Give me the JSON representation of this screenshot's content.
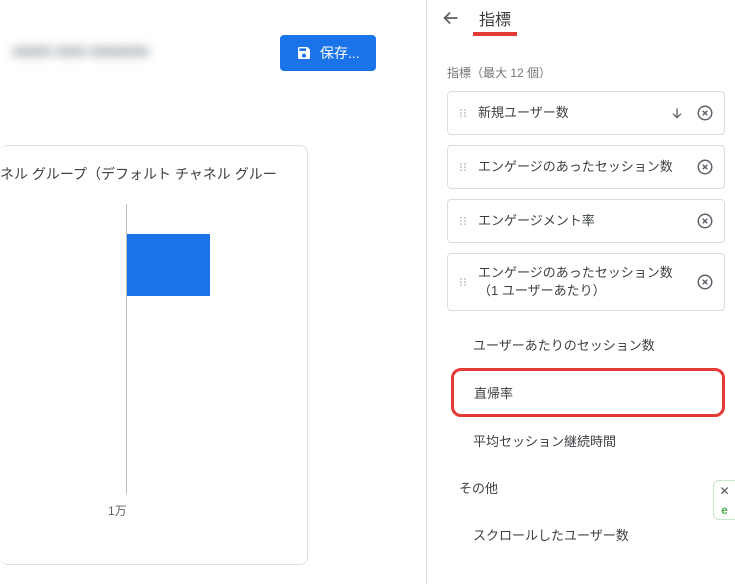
{
  "header": {
    "blurred_text": "■■■■ ■■■ ■■■■■■",
    "save_label": "保存..."
  },
  "card": {
    "title": "ネル グループ（デフォルト チャネル グルー"
  },
  "chart_data": {
    "type": "bar",
    "orientation": "horizontal",
    "x_tick_label": "1万",
    "x_tick_value": 10000,
    "bars": [
      {
        "value": 9200
      }
    ],
    "xlim": [
      0,
      20000
    ]
  },
  "panel": {
    "title": "指標",
    "subtitle": "指標（最大 12 個）",
    "selected_metrics": [
      {
        "label": "新規ユーザー数",
        "has_sort": true
      },
      {
        "label": "エンゲージのあったセッション数",
        "has_sort": false
      },
      {
        "label": "エンゲージメント率",
        "has_sort": false
      },
      {
        "label": "エンゲージのあったセッション数（1 ユーザーあたり）",
        "has_sort": false
      }
    ],
    "suggestions": [
      {
        "label": "ユーザーあたりのセッション数",
        "highlighted": false
      },
      {
        "label": "直帰率",
        "highlighted": true
      },
      {
        "label": "平均セッション継続時間",
        "highlighted": false
      }
    ],
    "category": "その他",
    "more_items": [
      {
        "label": "スクロールしたユーザー数"
      }
    ]
  }
}
